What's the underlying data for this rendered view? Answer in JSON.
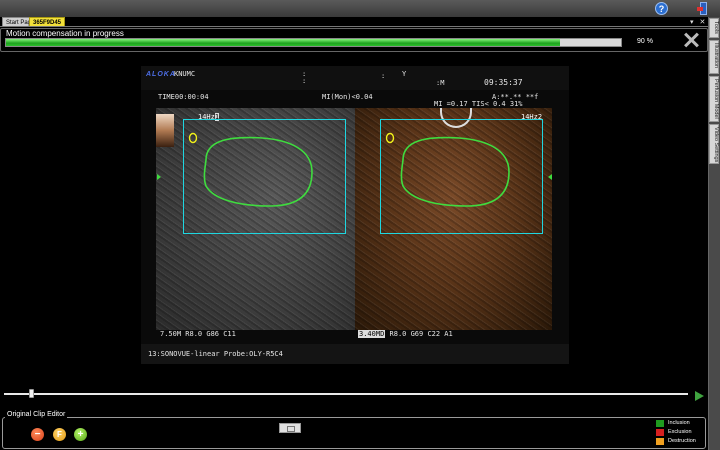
{
  "tabs": [
    {
      "label": "Start Page"
    },
    {
      "label": "365F9D45"
    }
  ],
  "header": {
    "help_label": "?"
  },
  "side_tabs": [
    {
      "label": "Tools"
    },
    {
      "label": "Illustration"
    },
    {
      "label": "Perfusion Model"
    },
    {
      "label": "Video Settings"
    }
  ],
  "progress": {
    "label": "Motion compensation in progress",
    "value": 0.9,
    "percent_text": "90 %"
  },
  "ultrasound": {
    "brand": "ALOKA",
    "institution": "KNUMC",
    "sep1": ":",
    "sep2": ":",
    "sex": "Y",
    "col_m": ":M",
    "clock": "09:35:37",
    "time": "TIME00:00:04",
    "mi_mon": "MI(Mon)<0.04",
    "accel": "A:**.** **f",
    "mi_tis": "MI =0.17  TIS< 0.4   31%",
    "freq_left": "14Hz",
    "freq_left_tag": "1",
    "freq_right": "14Hz",
    "freq_right_tag": "2",
    "params_left": "7.50M  R8.0  G86  C11",
    "params_right_badge": "3.40MD",
    "params_right": " R8.0  G69  C22  A1",
    "probe_line": "13:SONOVUE-linear  Probe:OLY-R5C4"
  },
  "timeline": {
    "position": 0.04
  },
  "clip_editor": {
    "title": "Original Clip Editor",
    "minus_label": "−",
    "f_label": "F",
    "plus_label": "+"
  },
  "legend": [
    {
      "label": "Inclusion",
      "color": "#1f9a1f"
    },
    {
      "label": "Exclusion",
      "color": "#d61f1f"
    },
    {
      "label": "Destruction",
      "color": "#f0a020"
    }
  ],
  "colors": {
    "roi_box": "#1fd6e0",
    "contour": "#3fdc3f",
    "marker": "#f2f21a",
    "progress_fill": "#2bbf2b"
  }
}
